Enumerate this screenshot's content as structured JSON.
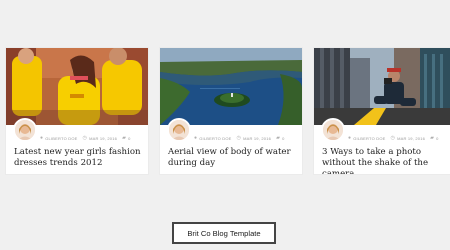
{
  "posts": [
    {
      "author": "GLIBERTO DOE",
      "date": "MAR 19, 2016",
      "comments": "0",
      "title": "Latest new year girls fashion dresses trends 2012"
    },
    {
      "author": "GILBERTO DOE",
      "date": "MAR 19, 2016",
      "comments": "0",
      "title": "Aerial view of body of  water during day"
    },
    {
      "author": "GILBERTO DOE",
      "date": "MAR 19, 2016",
      "comments": "0",
      "title": "3 Ways to take a photo without the shake of the camera"
    }
  ],
  "icons": {
    "author": "user-icon",
    "date": "clock-icon",
    "comments": "comment-icon"
  },
  "button": {
    "label": "Brit Co Blog Template"
  },
  "colors": {
    "background": "#f0f0f0",
    "card": "#ffffff",
    "title": "#222222",
    "meta": "#9a9a9a",
    "button_border": "#444444"
  }
}
